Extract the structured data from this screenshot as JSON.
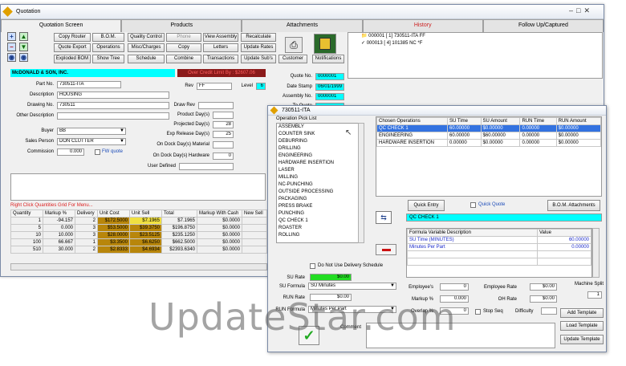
{
  "window": {
    "title": "Quotation"
  },
  "tabs": [
    {
      "label": "Quotation Screen"
    },
    {
      "label": "Products"
    },
    {
      "label": "Attachments"
    },
    {
      "label": "History"
    },
    {
      "label": "Follow Up/Captured"
    }
  ],
  "toolbar": {
    "row1": [
      "Copy Router",
      "B.O.M.",
      "Quality Control",
      "Phone",
      "View Assembly",
      "Recalculate"
    ],
    "row2": [
      "Quote Export",
      "Operations",
      "Misc/Charges",
      "Copy",
      "Letters",
      "Update Rates"
    ],
    "row3": [
      "Exploded BOM",
      "Show Tree",
      "Schedule",
      "Combine",
      "Transactions",
      "Update Sub's",
      "Customer",
      "Notifications"
    ]
  },
  "tree": [
    {
      "text": "000001 [ 1] 730511-ITA FF"
    },
    {
      "text": "000013 [ 4] 101385 NC *F"
    }
  ],
  "customer": {
    "name": "McDONALD & SON, INC.",
    "credit_warning": "Over Credit Limit By : $2607.06"
  },
  "form": {
    "part_no_label": "Part No.",
    "part_no": "730511-ITA",
    "description_label": "Description",
    "description": "HOUSING",
    "drawing_no_label": "Drawing No.",
    "drawing_no": "730511",
    "other_desc_label": "Other Description",
    "other_desc": "",
    "rev_label": "Rev",
    "rev": "FF",
    "level_label": "Level",
    "level": "6",
    "draw_rev_label": "Draw Rev",
    "product_days_label": "Product Day(s)",
    "projected_days_label": "Projected Day(s)",
    "projected_days": "28",
    "exp_release_label": "Exp Release Day(s)",
    "exp_release": "25",
    "dock_material_label": "On Dock Day(s) Material",
    "dock_hardware_label": "On Dock Day(s) Hardware",
    "dock_hardware": "0",
    "user_defined_label": "User Defined",
    "buyer_label": "Buyer",
    "buyer": "BB",
    "sales_person_label": "Sales Person",
    "sales_person": "DON CLUTTER",
    "commission_label": "Commission",
    "commission": "0.000",
    "fw_quote_label": "FW quote",
    "quote_no_label": "Quote No.",
    "quote_no": "0000001",
    "date_stamp_label": "Date Stamp",
    "date_stamp": "06/01/1999",
    "assembly_no_label": "Assembly No.",
    "assembly_no": "0000001",
    "to_quote_label": "To Quote"
  },
  "quantity_grid": {
    "hint": "Right Click Quantities Grid For Menu...",
    "columns": [
      "Quantity",
      "Markup %",
      "Delivery",
      "Unit Cost",
      "Unit Sell",
      "Total",
      "Markup With Cash",
      "New Sell"
    ],
    "rows": [
      [
        "1",
        "-94.157",
        "2",
        "$172.5000",
        "$7.1965",
        "$7.1965",
        "$0.0000",
        ""
      ],
      [
        "5",
        "0.000",
        "3",
        "$53.5000",
        "$39.3750",
        "$196.8750",
        "$0.0000",
        ""
      ],
      [
        "10",
        "10.000",
        "3",
        "$28.0000",
        "$23.5125",
        "$235.1250",
        "$0.0000",
        ""
      ],
      [
        "100",
        "66.667",
        "1",
        "$3.3500",
        "$6.6250",
        "$662.5000",
        "$0.0000",
        ""
      ],
      [
        "510",
        "30.000",
        "2",
        "$2.8333",
        "$4.6934",
        "$2393.6340",
        "$0.0000",
        ""
      ]
    ]
  },
  "dialog": {
    "title": "730511-ITA",
    "pick_list_label": "Operation Pick List",
    "pick_list": [
      "ASSEMBLY",
      "COUNTER SINK",
      "DEBURRING",
      "DRILLING",
      "ENGINEERING",
      "HARDWARE INSERTION",
      "LASER",
      "MILLING",
      "NC-PUNCHING",
      "OUTSIDE PROCESSING",
      "PACKAGING",
      "PRESS BRAKE",
      "PUNCHING",
      "QC CHECK 1",
      "ROASTER",
      "ROLLING"
    ],
    "chosen_columns": [
      "Chosen Operations",
      "SU Time",
      "SU Amount",
      "RUN Time",
      "RUN Amount"
    ],
    "chosen_rows": [
      [
        "QC CHECK 1",
        "60.00000",
        "$0.00000",
        "0.00000",
        "$0.00000"
      ],
      [
        "ENGINEERING",
        "60.00000",
        "$60.00000",
        "0.00000",
        "$0.00000"
      ],
      [
        "HARDWARE INSERTION",
        "0.00000",
        "$0.00000",
        "0.00000",
        "$0.00000"
      ]
    ],
    "quick_entry": "Quick Entry",
    "quick_quote": "Quick Quote",
    "bom_attachments": "B.O.M. Attachments",
    "selected_op": "QC CHECK 1",
    "formula_columns": [
      "Formula Variable Description",
      "Value"
    ],
    "formula_rows": [
      [
        "SU Time (MINUTES)",
        "60.00000"
      ],
      [
        "Minutes Per Part",
        "0.00000"
      ]
    ],
    "no_delivery_label": "Do Not Use Delivery Schedule",
    "su_rate_label": "SU Rate",
    "su_rate": "$0.00",
    "su_formula_label": "SU Formula",
    "su_formula": "SU Minutes",
    "run_rate_label": "RUN Rate",
    "run_rate": "$0.00",
    "run_formula_label": "RUN Formula",
    "run_formula": "Minutes Per Part",
    "employees_label": "Employee's",
    "employees": "0",
    "markup_label": "Markup %",
    "markup": "0.000",
    "overlap_label": "Overlap %",
    "overlap": "0",
    "employee_rate_label": "Employee Rate",
    "employee_rate": "$0.00",
    "oh_rate_label": "OH Rate",
    "oh_rate": "$0.00",
    "stop_seq_label": "Stop Seq",
    "difficulty_label": "Difficulty",
    "machine_split_label": "Machine Split",
    "machine_split": "1",
    "comment_label": "Comment",
    "add_template": "Add Template",
    "load_template": "Load Template",
    "update_template": "Update Template"
  },
  "watermark": "UpdateStar.com"
}
